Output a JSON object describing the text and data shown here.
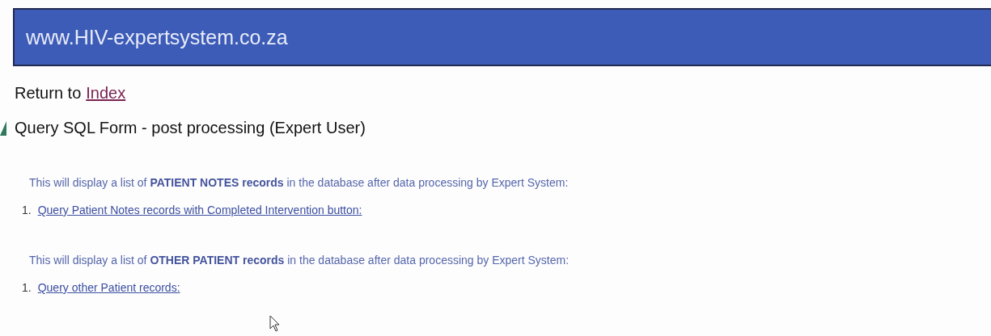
{
  "banner": {
    "title": "www.HIV-expertsystem.co.za"
  },
  "return_line": {
    "prefix": "Return to",
    "link": "Index"
  },
  "heading": "Query SQL Form - post processing (Expert User)",
  "sections": [
    {
      "description": "This will display a list of **PATIENT NOTES records** in the database after data processing by Expert System:",
      "items": [
        {
          "number": "1.",
          "link": "Query Patient Notes records with Completed Intervention button:"
        }
      ]
    },
    {
      "description": "This will display a list of **OTHER PATIENT records** in the database after data processing by Expert System:",
      "items": [
        {
          "number": "1.",
          "link": "Query other Patient records:"
        }
      ]
    }
  ]
}
